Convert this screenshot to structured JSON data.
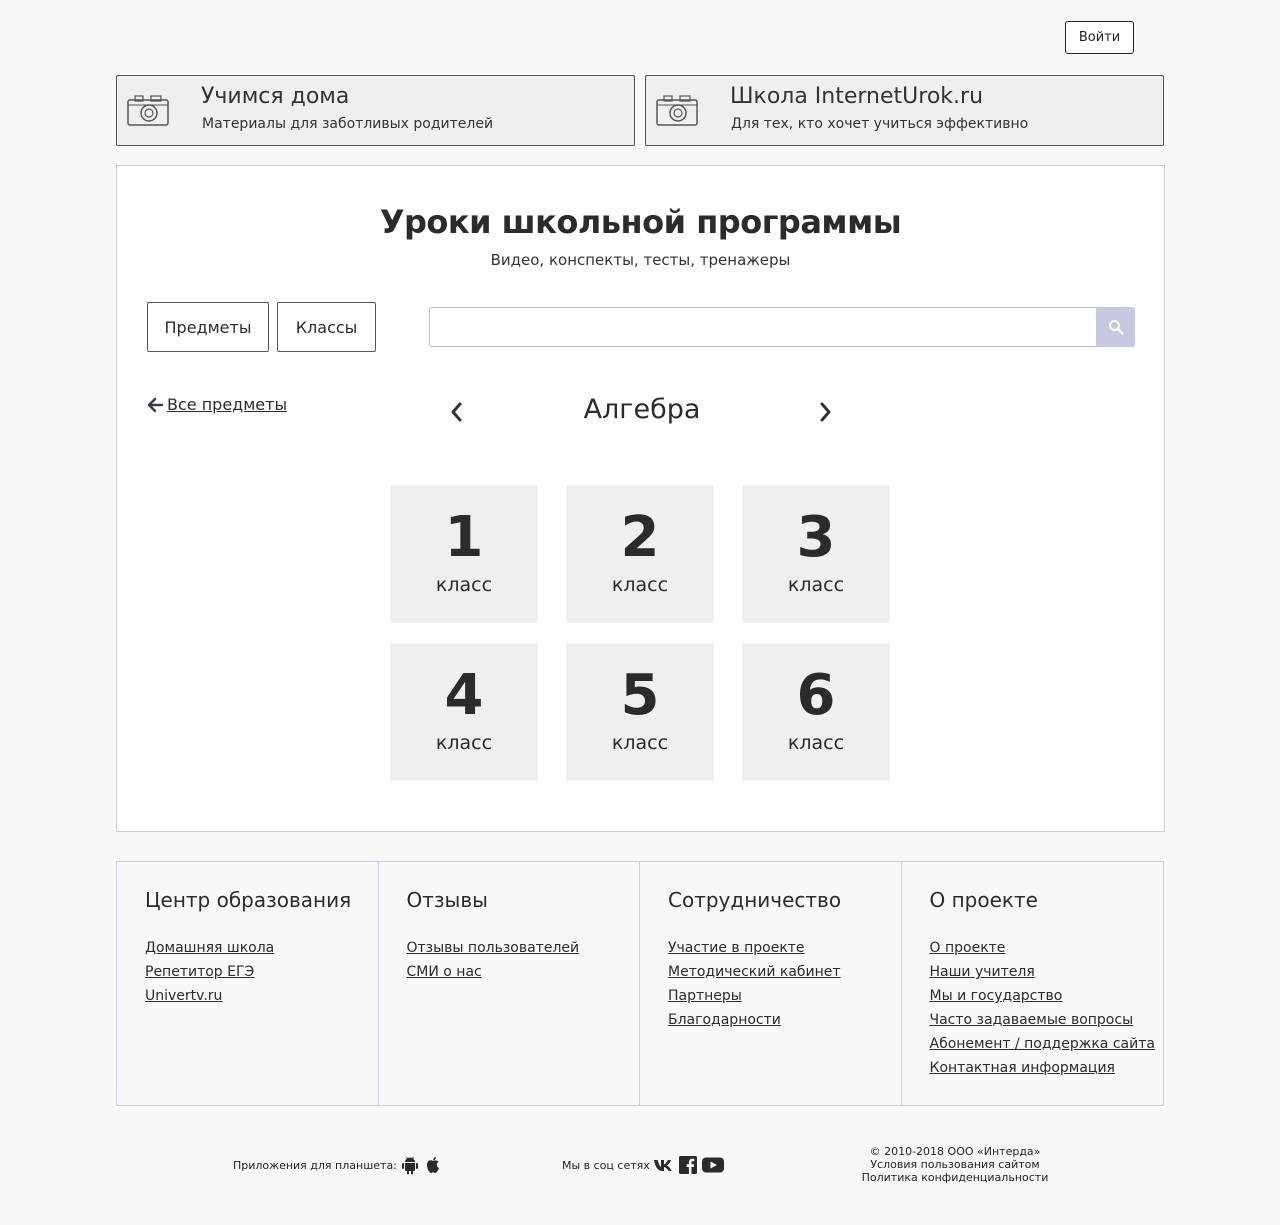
{
  "header": {
    "login_label": "Войти"
  },
  "promos": [
    {
      "title": "Учимся дома",
      "subtitle": "Материалы для заботливых родителей",
      "icon": "camera-icon"
    },
    {
      "title": "Школа InternetUrok.ru",
      "subtitle": "Для тех, кто хочет учиться эффективно",
      "icon": "camera-icon"
    }
  ],
  "main": {
    "title": "Уроки школьной программы",
    "subtitle": "Видео, конспекты, тесты, тренажеры",
    "tabs": [
      {
        "label": "Предметы"
      },
      {
        "label": "Классы"
      }
    ],
    "search": {
      "value": "",
      "placeholder": "",
      "icon": "search-icon"
    },
    "back_link": "Все предметы",
    "subject": "Алгебра",
    "grades": [
      {
        "number": "1",
        "word": "класс"
      },
      {
        "number": "2",
        "word": "класс"
      },
      {
        "number": "3",
        "word": "класс"
      },
      {
        "number": "4",
        "word": "класс"
      },
      {
        "number": "5",
        "word": "класс"
      },
      {
        "number": "6",
        "word": "класс"
      }
    ]
  },
  "footer": {
    "columns": [
      {
        "heading": "Центр образования",
        "links": [
          "Домашняя школа",
          "Репетитор ЕГЭ",
          "Univertv.ru"
        ]
      },
      {
        "heading": "Отзывы",
        "links": [
          "Отзывы пользователей",
          "СМИ о нас"
        ]
      },
      {
        "heading": "Сотрудничество",
        "links": [
          "Участие в проекте",
          "Методический кабинет",
          "Партнеры",
          "Благодарности"
        ]
      },
      {
        "heading": "О проекте",
        "links": [
          "О проекте",
          "Наши учителя",
          "Мы и государство",
          "Часто задаваемые вопросы",
          "Абонемент / поддержка сайта",
          "Контактная информация"
        ]
      }
    ]
  },
  "bottom": {
    "apps_label": "Приложения для планшета:",
    "social_label": "Мы в соц сетях",
    "copyright": "© 2010-2018 ООО «Интерда»",
    "terms": "Условия пользования сайтом",
    "privacy": "Политика конфиденциальности"
  },
  "colors": {
    "accent_search": "#c6c8e2",
    "tile_bg": "#efefef",
    "footer_border": "#cccde6"
  }
}
